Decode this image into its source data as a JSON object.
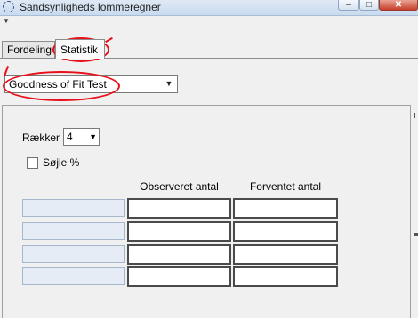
{
  "window": {
    "title": "Sandsynligheds lommeregner",
    "minimize": "–",
    "maximize": "□",
    "close": "✕",
    "app_icon": "settings-cog-icon"
  },
  "menu": {
    "arrow": "▼"
  },
  "tabs": [
    {
      "label": "Fordeling",
      "selected": false
    },
    {
      "label": "Statistik",
      "selected": true
    }
  ],
  "test_select": {
    "value": "Goodness of Fit Test",
    "arrow": "▼"
  },
  "rows_control": {
    "label": "Rækker",
    "value": "4",
    "arrow": "▼"
  },
  "percent_checkbox": {
    "label": "Søjle %",
    "checked": false
  },
  "table": {
    "columns": [
      "Observeret antal",
      "Forventet antal"
    ],
    "rows": [
      {
        "label": "",
        "observed": "",
        "expected": ""
      },
      {
        "label": "",
        "observed": "",
        "expected": ""
      },
      {
        "label": "",
        "observed": "",
        "expected": ""
      },
      {
        "label": "",
        "observed": "",
        "expected": ""
      }
    ]
  },
  "colors": {
    "annotation": "#e8101a",
    "row_label_bg": "#e6ecf5"
  }
}
